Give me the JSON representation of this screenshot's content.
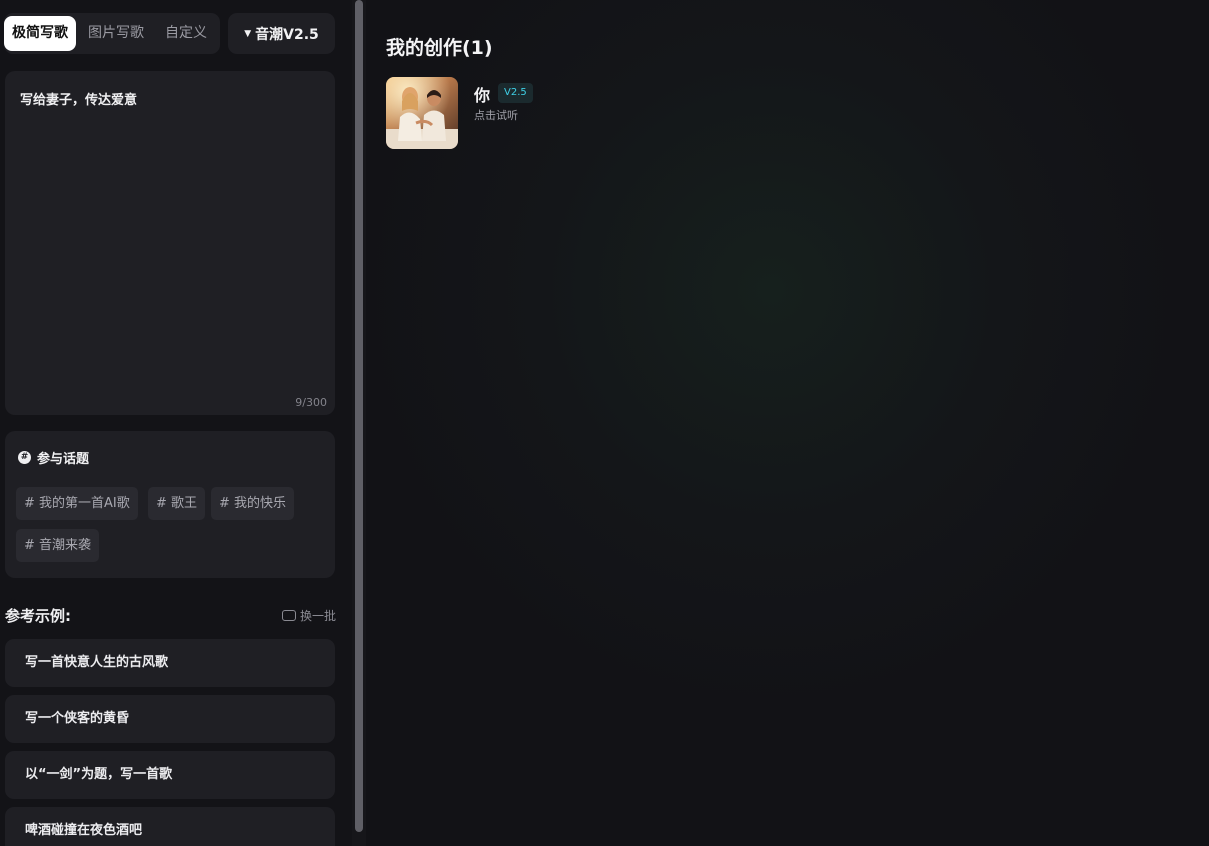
{
  "mode_tabs": {
    "simple": "极简写歌",
    "image": "图片写歌",
    "custom": "自定义"
  },
  "version_select": {
    "label": "音潮V2.5"
  },
  "prompt": {
    "text": "写给妻子，传达爱意",
    "char_count": "9/300"
  },
  "topics": {
    "header": "参与话题",
    "tags": [
      "# 我的第一首AI歌",
      "# 歌王",
      "# 我的快乐",
      "# 音潮来袭"
    ]
  },
  "examples": {
    "title": "参考示例:",
    "shuffle_label": "换一批",
    "items": [
      "写一首快意人生的古风歌",
      "写一个侠客的黄昏",
      "以“一剑”为题，写一首歌",
      "啤酒碰撞在夜色酒吧"
    ]
  },
  "creations": {
    "title": "我的创作(1)",
    "songs": [
      {
        "title": "你",
        "version": "V2.5",
        "hint": "点击试听"
      }
    ]
  }
}
